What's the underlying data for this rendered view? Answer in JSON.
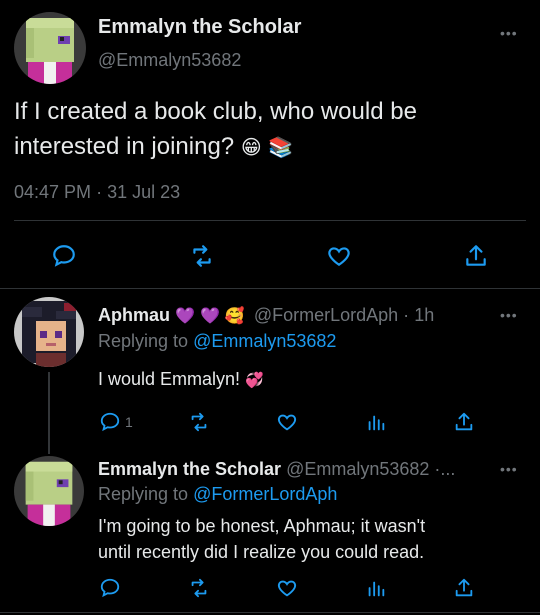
{
  "main_tweet": {
    "display_name": "Emmalyn the Scholar",
    "handle": "@Emmalyn53682",
    "text_line1": "If I created a book club, who would be",
    "text_line2": "interested in joining?",
    "emojis": [
      "😁",
      "📚"
    ],
    "time": "04:47 PM",
    "separator": "·",
    "date": "31 Jul 23",
    "more_menu": "•••"
  },
  "reply1": {
    "display_name": "Aphmau",
    "name_emojis": [
      "💜",
      "💜",
      "🥰"
    ],
    "handle": "@FormerLordAph",
    "time_separator": "·",
    "time": "1h",
    "replying_to_label": "Replying to",
    "replying_to_handle": "@Emmalyn53682",
    "text": "I would Emmalyn!",
    "text_emoji": "💞",
    "reply_count": "1",
    "more_menu": "•••"
  },
  "reply2": {
    "display_name": "Emmalyn the Scholar",
    "handle_truncated": "@Emmalyn53682 ·...",
    "replying_to_label": "Replying to",
    "replying_to_handle": "@FormerLordAph",
    "text_line1": "I'm going to be honest, Aphmau; it wasn't",
    "text_line2": "until recently did I realize you could read.",
    "more_menu": "•••"
  },
  "colors": {
    "background": "#000000",
    "text": "#e7e9ea",
    "muted": "#71767b",
    "link": "#1d9bf0",
    "divider": "#2f3336"
  },
  "icons": [
    "reply-icon",
    "retweet-icon",
    "like-icon",
    "share-icon",
    "views-icon",
    "more-icon"
  ]
}
